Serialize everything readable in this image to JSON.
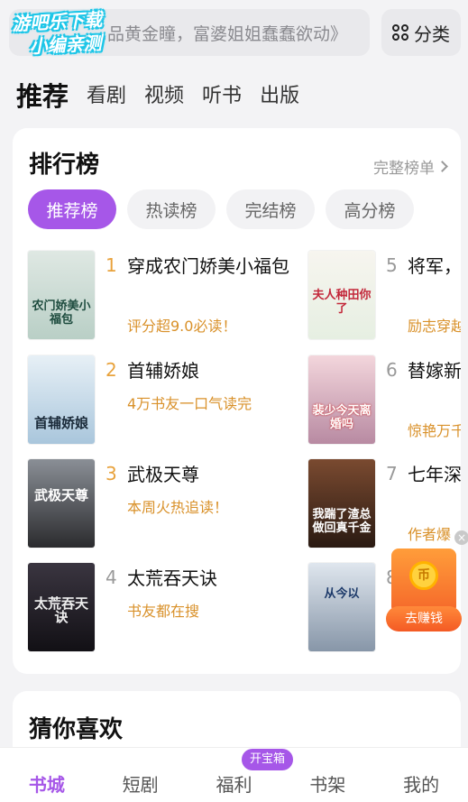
{
  "watermark": {
    "line1": "游吧乐下载",
    "line2": "小编亲测"
  },
  "search": {
    "placeholder": "…品黄金瞳，富婆姐姐蠢蠢欲动》"
  },
  "category_button": {
    "label": "分类",
    "icon": "grid-icon"
  },
  "channel_tabs": [
    {
      "label": "推荐",
      "active": true
    },
    {
      "label": "看剧"
    },
    {
      "label": "视频"
    },
    {
      "label": "听书"
    },
    {
      "label": "出版"
    }
  ],
  "ranking": {
    "title": "排行榜",
    "more_label": "完整榜单",
    "tabs": [
      {
        "label": "推荐榜",
        "active": true
      },
      {
        "label": "热读榜"
      },
      {
        "label": "完结榜"
      },
      {
        "label": "高分榜"
      }
    ],
    "books": [
      {
        "rank": "1",
        "title": "穿成农门娇美小福包",
        "tag": "评分超9.0必读！",
        "cover_text": "农门娇美小福包"
      },
      {
        "rank": "2",
        "title": "首辅娇娘",
        "tag": "4万书友一口气读完",
        "cover_text": "首辅娇娘"
      },
      {
        "rank": "3",
        "title": "武极天尊",
        "tag": "本周火热追读！",
        "cover_text": "武极天尊"
      },
      {
        "rank": "4",
        "title": "太荒吞天诀",
        "tag": "书友都在搜",
        "cover_text": "太荒吞天诀"
      },
      {
        "rank": "5",
        "title": "将军，田了",
        "tag": "励志穿越",
        "cover_text": "夫人种田你了"
      },
      {
        "rank": "6",
        "title": "替嫁新娘今天离",
        "tag": "惊艳万千",
        "cover_text": "裴少今天离婚吗"
      },
      {
        "rank": "7",
        "title": "七年深情踹了渣",
        "tag": "作者爆",
        "cover_text": "我踹了渣总做回真千金"
      },
      {
        "rank": "8",
        "title": "",
        "tag": "",
        "cover_text": "从今以"
      }
    ]
  },
  "treasure": {
    "label": "去赚钱",
    "coin_glyph": "币",
    "close_glyph": "×"
  },
  "guess": {
    "title": "猜你喜欢"
  },
  "bottom_nav": {
    "items": [
      {
        "label": "书城",
        "active": true
      },
      {
        "label": "短剧"
      },
      {
        "label": "福利"
      },
      {
        "label": "书架"
      },
      {
        "label": "我的"
      }
    ],
    "badge": "开宝箱"
  },
  "colors": {
    "accent": "#a657e8",
    "tag_orange": "#d9912a",
    "rank_gold": "#e8a23c"
  }
}
